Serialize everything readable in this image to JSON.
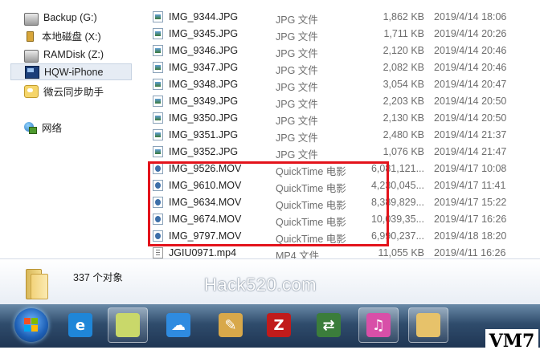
{
  "navigation": {
    "items": [
      {
        "label": "Backup (G:)",
        "icon": "drive-icon"
      },
      {
        "label": "本地磁盘 (X:)",
        "icon": "usb-drive-icon"
      },
      {
        "label": "RAMDisk (Z:)",
        "icon": "drive-icon"
      },
      {
        "label": "HQW-iPhone",
        "icon": "iphone-icon",
        "selected": true
      },
      {
        "label": "微云同步助手",
        "icon": "weiyun-icon"
      },
      {
        "label": "网络",
        "icon": "network-icon"
      }
    ]
  },
  "files": [
    {
      "name": "IMG_9344.JPG",
      "type": "JPG 文件",
      "size": "1,862 KB",
      "date": "2019/4/14 18:06",
      "icon": "jpg-file-icon"
    },
    {
      "name": "IMG_9345.JPG",
      "type": "JPG 文件",
      "size": "1,711 KB",
      "date": "2019/4/14 20:26",
      "icon": "jpg-file-icon"
    },
    {
      "name": "IMG_9346.JPG",
      "type": "JPG 文件",
      "size": "2,120 KB",
      "date": "2019/4/14 20:46",
      "icon": "jpg-file-icon"
    },
    {
      "name": "IMG_9347.JPG",
      "type": "JPG 文件",
      "size": "2,082 KB",
      "date": "2019/4/14 20:46",
      "icon": "jpg-file-icon"
    },
    {
      "name": "IMG_9348.JPG",
      "type": "JPG 文件",
      "size": "3,054 KB",
      "date": "2019/4/14 20:47",
      "icon": "jpg-file-icon"
    },
    {
      "name": "IMG_9349.JPG",
      "type": "JPG 文件",
      "size": "2,203 KB",
      "date": "2019/4/14 20:50",
      "icon": "jpg-file-icon"
    },
    {
      "name": "IMG_9350.JPG",
      "type": "JPG 文件",
      "size": "2,130 KB",
      "date": "2019/4/14 20:50",
      "icon": "jpg-file-icon"
    },
    {
      "name": "IMG_9351.JPG",
      "type": "JPG 文件",
      "size": "2,480 KB",
      "date": "2019/4/14 21:37",
      "icon": "jpg-file-icon"
    },
    {
      "name": "IMG_9352.JPG",
      "type": "JPG 文件",
      "size": "1,076 KB",
      "date": "2019/4/14 21:47",
      "icon": "jpg-file-icon"
    },
    {
      "name": "IMG_9526.MOV",
      "type": "QuickTime 电影",
      "size": "6,081,121...",
      "date": "2019/4/17 10:08",
      "icon": "mov-file-icon"
    },
    {
      "name": "IMG_9610.MOV",
      "type": "QuickTime 电影",
      "size": "4,230,045...",
      "date": "2019/4/17 11:41",
      "icon": "mov-file-icon"
    },
    {
      "name": "IMG_9634.MOV",
      "type": "QuickTime 电影",
      "size": "8,389,829...",
      "date": "2019/4/17 15:22",
      "icon": "mov-file-icon"
    },
    {
      "name": "IMG_9674.MOV",
      "type": "QuickTime 电影",
      "size": "10,039,35...",
      "date": "2019/4/17 16:26",
      "icon": "mov-file-icon"
    },
    {
      "name": "IMG_9797.MOV",
      "type": "QuickTime 电影",
      "size": "6,990,237...",
      "date": "2019/4/18 18:20",
      "icon": "mov-file-icon"
    },
    {
      "name": "JGIU0971.mp4",
      "type": "MP4 文件",
      "size": "11,055 KB",
      "date": "2019/4/11 16:26",
      "icon": "mp4-file-icon"
    }
  ],
  "details": {
    "item_count": "337 个对象",
    "icon": "folder-icon"
  },
  "watermark": "Hack520.com",
  "corner_label": "VM7",
  "highlight_color": "#e3131b",
  "taskbar": {
    "start_icon": "windows-start-icon",
    "apps": [
      {
        "name": "internet-explorer-icon",
        "glyph": "e",
        "color": "#1f86d8",
        "active": false
      },
      {
        "name": "sticky-notes-icon",
        "glyph": "",
        "color": "#c9d86a",
        "active": true
      },
      {
        "name": "baidu-cloud-icon",
        "glyph": "☁",
        "color": "#2f8be0",
        "active": false
      },
      {
        "name": "paint-tool-icon",
        "glyph": "✎",
        "color": "#d8a84a",
        "active": false
      },
      {
        "name": "filezilla-icon",
        "glyph": "Z",
        "color": "#c11b1b",
        "active": false
      },
      {
        "name": "sharing-tool-icon",
        "glyph": "⇄",
        "color": "#3b7d3b",
        "active": false
      },
      {
        "name": "itunes-icon",
        "glyph": "♫",
        "color": "#d84fa8",
        "active": true
      },
      {
        "name": "windows-explorer-icon",
        "glyph": "",
        "color": "#e7c26a",
        "active": true
      }
    ]
  }
}
